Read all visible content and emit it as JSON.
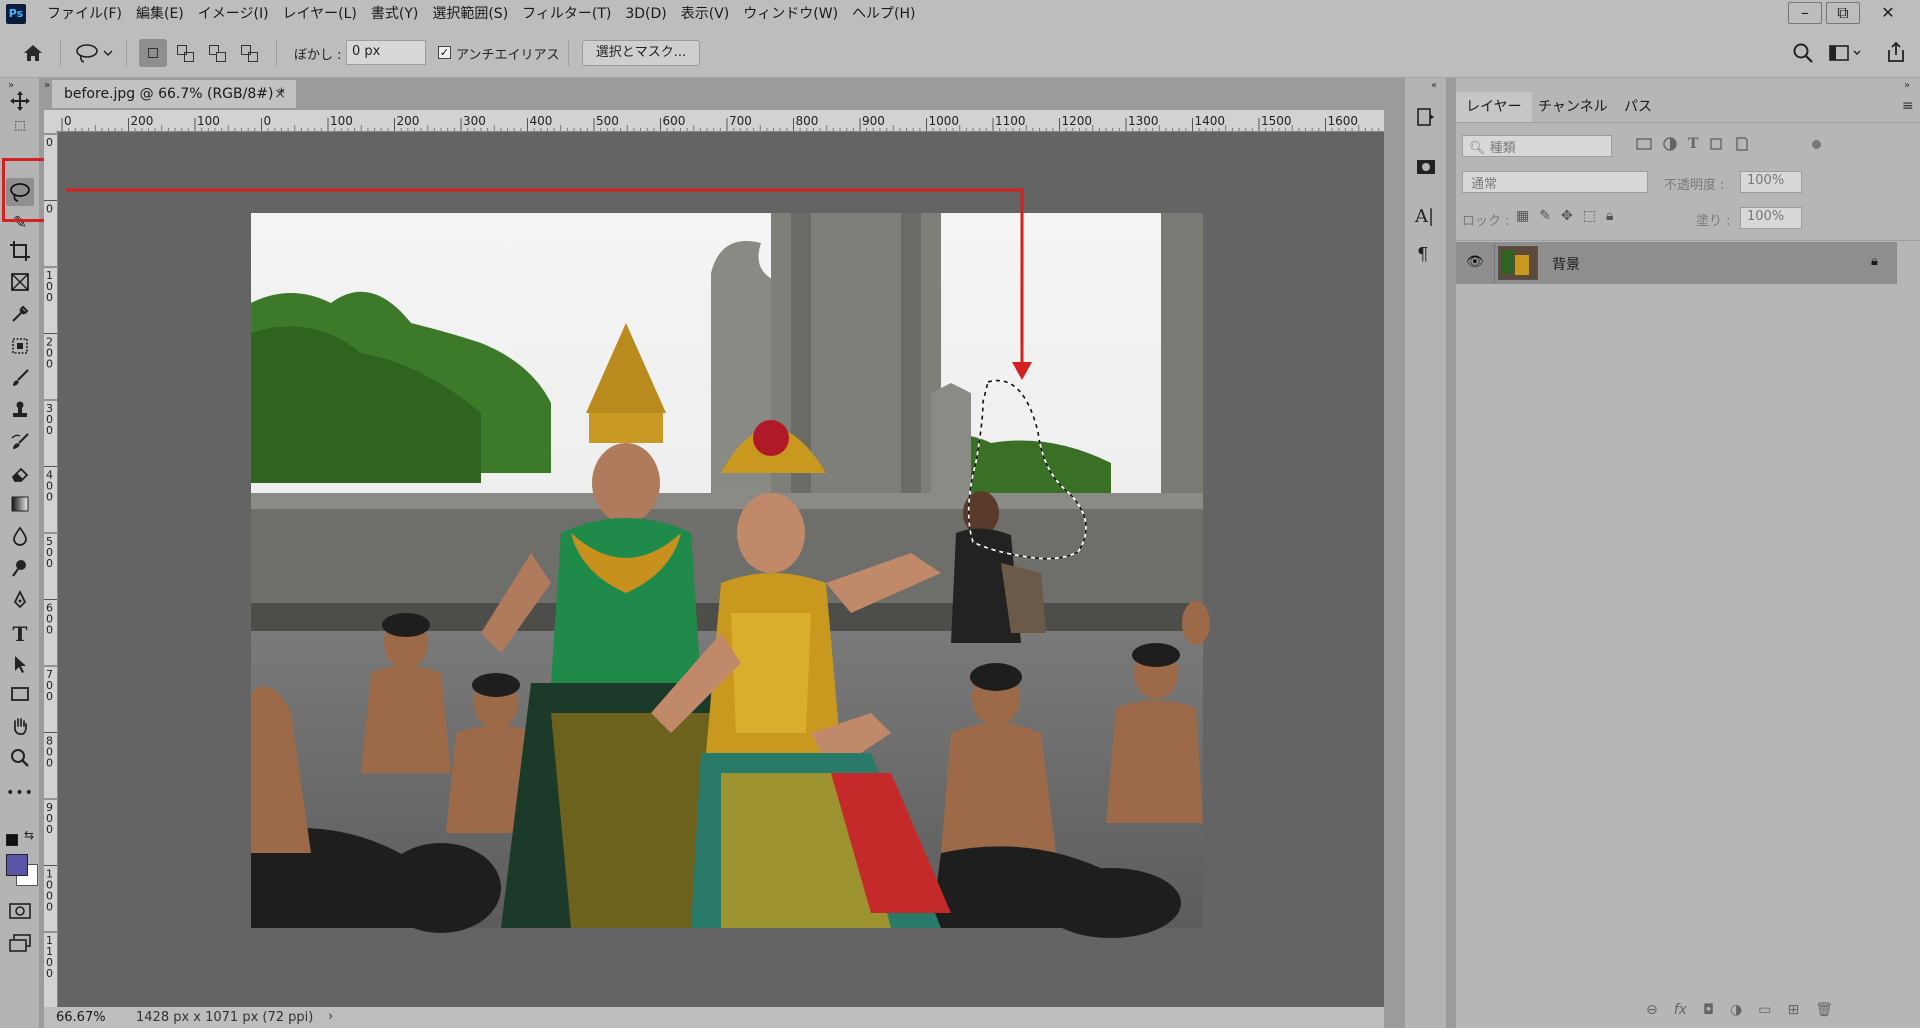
{
  "app": {
    "logo": "Ps"
  },
  "menu": [
    "ファイル(F)",
    "編集(E)",
    "イメージ(I)",
    "レイヤー(L)",
    "書式(Y)",
    "選択範囲(S)",
    "フィルター(T)",
    "3D(D)",
    "表示(V)",
    "ウィンドウ(W)",
    "ヘルプ(H)"
  ],
  "window_controls": {
    "minimize": "–",
    "restore": "⧉",
    "close": "✕"
  },
  "options": {
    "feather_label": "ぼかし :",
    "feather_value": "0 px",
    "antialias_label": "アンチエイリアス",
    "antialias_checked": true,
    "select_mask_button": "選択とマスク..."
  },
  "document": {
    "tab_title": "before.jpg @ 66.7% (RGB/8#) *",
    "close_glyph": "×",
    "zoom": "66.67%",
    "dimensions": "1428 px x 1071 px (72 ppi)",
    "status_arrow": "›"
  },
  "ruler": {
    "h_labels": [
      "0",
      "200",
      "100",
      "0",
      "100",
      "200",
      "300",
      "400",
      "500",
      "600",
      "700",
      "800",
      "900",
      "1000",
      "1100",
      "1200",
      "1300",
      "1400",
      "1500",
      "1600"
    ],
    "v_labels": [
      "0",
      "0",
      "100",
      "200",
      "300",
      "400",
      "500",
      "600",
      "700",
      "800",
      "900",
      "1000",
      "1100"
    ]
  },
  "layers_panel": {
    "tabs": [
      "レイヤー",
      "チャンネル",
      "パス"
    ],
    "active_tab": 0,
    "filter_placeholder": "種類",
    "blend_mode": "通常",
    "opacity_label": "不透明度 :",
    "opacity_value": "100%",
    "lock_label": "ロック :",
    "fill_label": "塗り :",
    "fill_value": "100%",
    "layers": [
      {
        "name": "背景",
        "visible": true,
        "locked": true
      }
    ]
  },
  "colors": {
    "foreground": "#5a55a8",
    "background": "#ffffff",
    "highlight": "#d42020"
  },
  "icons": [
    "home-icon",
    "lasso-icon",
    "move-icon",
    "crop-icon",
    "eyedropper-icon",
    "brush-icon",
    "stamp-icon",
    "eraser-icon",
    "gradient-icon",
    "pen-icon",
    "type-icon",
    "hand-icon",
    "zoom-icon",
    "search-icon",
    "share-icon"
  ]
}
